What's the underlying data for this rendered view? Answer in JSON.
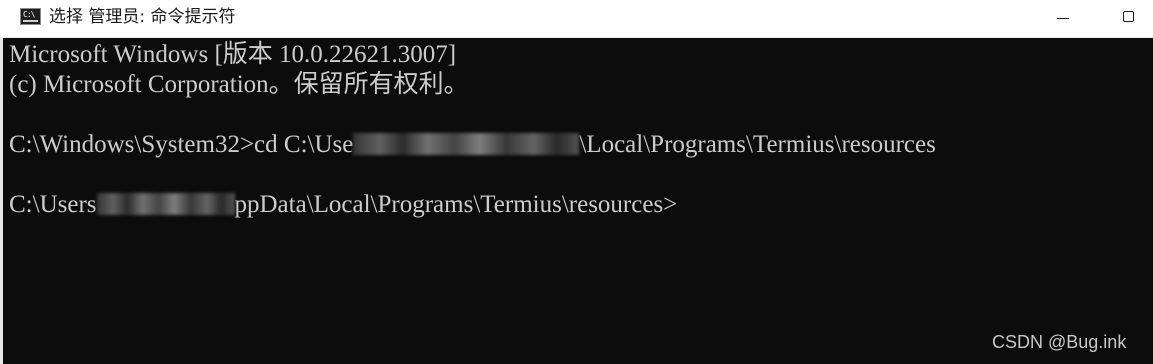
{
  "window": {
    "title": "选择 管理员: 命令提示符",
    "icon": "cmd-icon",
    "icon_prompt": "C:\\",
    "controls": {
      "minimize": "minimize-icon",
      "maximize": "maximize-icon"
    }
  },
  "console": {
    "line1": "Microsoft Windows [版本 10.0.22621.3007]",
    "line2": "(c) Microsoft Corporation。保留所有权利。",
    "line3_before": "C:\\Windows\\System32>cd C:\\Use",
    "line3_after": "\\Local\\Programs\\Termius\\resources",
    "line4_before": "C:\\Users",
    "line4_after": "ppData\\Local\\Programs\\Termius\\resources>"
  },
  "watermark": "CSDN @Bug.ink"
}
